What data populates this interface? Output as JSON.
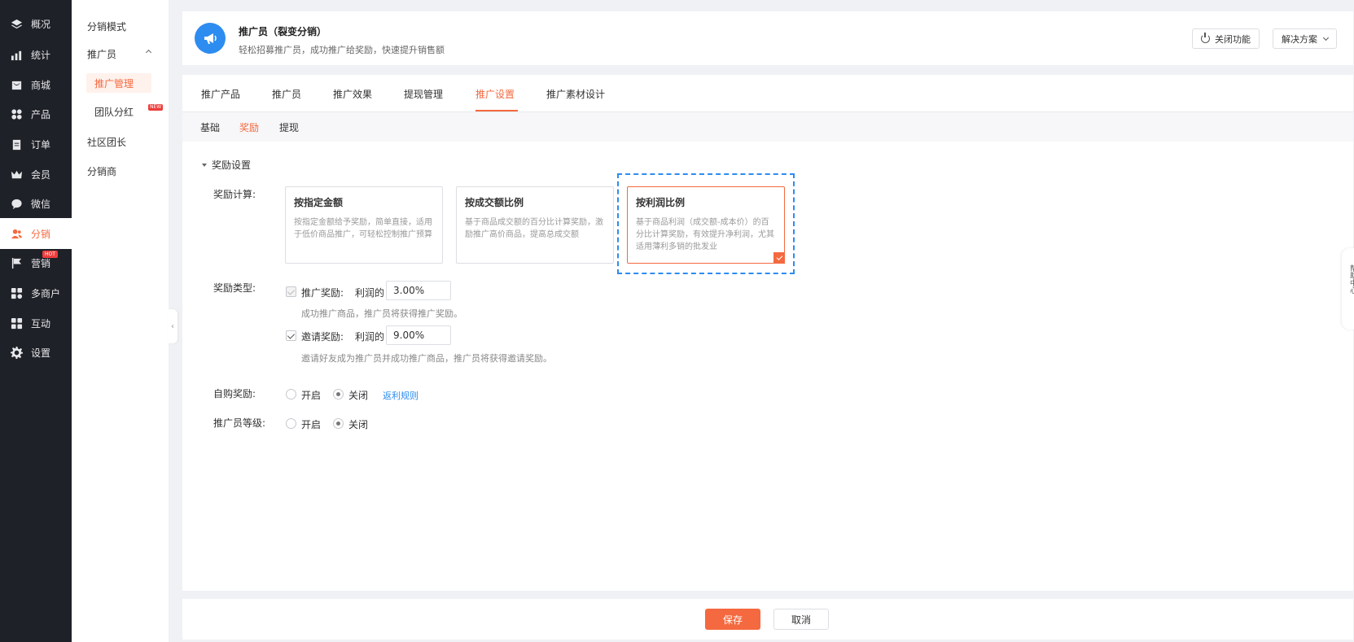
{
  "nav": {
    "items": [
      {
        "label": "概况",
        "icon": "layers-icon"
      },
      {
        "label": "统计",
        "icon": "chart-icon"
      },
      {
        "label": "商城",
        "icon": "shop-icon"
      },
      {
        "label": "产品",
        "icon": "grid-icon"
      },
      {
        "label": "订单",
        "icon": "clipboard-icon"
      },
      {
        "label": "会员",
        "icon": "crown-icon"
      },
      {
        "label": "微信",
        "icon": "wechat-icon"
      },
      {
        "label": "分销",
        "icon": "users-icon"
      },
      {
        "label": "营销",
        "icon": "flag-icon",
        "badge": "HOT"
      },
      {
        "label": "多商户",
        "icon": "store-icon"
      },
      {
        "label": "互动",
        "icon": "interact-icon"
      },
      {
        "label": "设置",
        "icon": "gear-icon"
      }
    ]
  },
  "subnav": {
    "items": [
      {
        "label": "分销模式"
      },
      {
        "label": "推广员"
      },
      {
        "label": "推广管理"
      },
      {
        "label": "团队分红",
        "badge": "NEW"
      },
      {
        "label": "社区团长"
      },
      {
        "label": "分销商"
      }
    ]
  },
  "header": {
    "title": "推广员（裂变分销）",
    "desc": "轻松招募推广员，成功推广给奖励，快速提升销售额",
    "close_btn": "关闭功能",
    "solution_btn": "解决方案"
  },
  "tabs": [
    "推广产品",
    "推广员",
    "推广效果",
    "提现管理",
    "推广设置",
    "推广素材设计"
  ],
  "subtabs": [
    "基础",
    "奖励",
    "提现"
  ],
  "form": {
    "section_title": "奖励设置",
    "calc_label": "奖励计算:",
    "cards": [
      {
        "title": "按指定金额",
        "desc": "按指定金额给予奖励，简单直接，适用于低价商品推广，可轻松控制推广预算"
      },
      {
        "title": "按成交额比例",
        "desc": "基于商品成交额的百分比计算奖励，激励推广高价商品，提高总成交额"
      },
      {
        "title": "按利润比例",
        "desc": "基于商品利润（成交额-成本价）的百分比计算奖励，有效提升净利润，尤其适用薄利多销的批发业"
      }
    ],
    "type_label": "奖励类型:",
    "promo_reward": {
      "label": "推广奖励:",
      "profit_label": "利润的",
      "value": "3.00%",
      "hint": "成功推广商品，推广员将获得推广奖励。"
    },
    "invite_reward": {
      "label": "邀请奖励:",
      "profit_label": "利润的",
      "value": "9.00%",
      "hint": "邀请好友成为推广员并成功推广商品，推广员将获得邀请奖励。"
    },
    "self_buy": {
      "label": "自购奖励:",
      "on": "开启",
      "off": "关闭",
      "link": "返利规则"
    },
    "level": {
      "label": "推广员等级:",
      "on": "开启",
      "off": "关闭"
    }
  },
  "footer": {
    "save": "保存",
    "cancel": "取消"
  },
  "side_float": "帮助中心",
  "colors": {
    "accent": "#f4693f",
    "nav_bg": "#1f2128",
    "link": "#2d8cf0"
  }
}
